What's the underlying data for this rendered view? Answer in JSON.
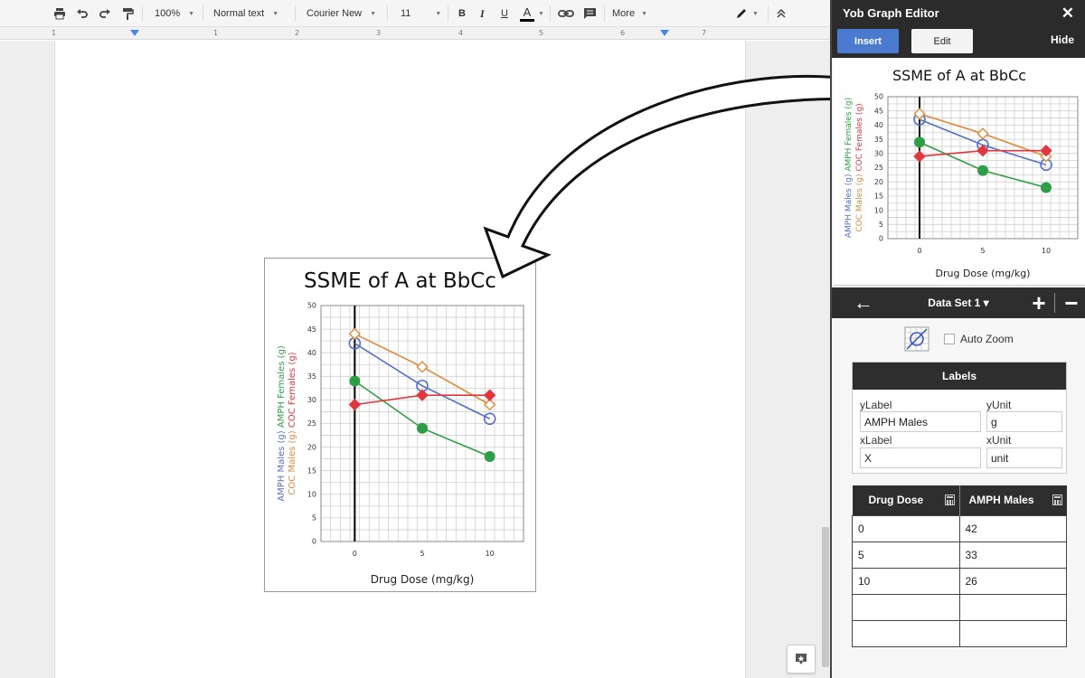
{
  "toolbar": {
    "zoom": "100%",
    "style": "Normal text",
    "font": "Courier New",
    "font_size": "11",
    "more": "More",
    "bold": "B",
    "italic": "I",
    "underline": "U",
    "text_color": "A"
  },
  "ruler": {
    "numbers": [
      "1",
      "1",
      "2",
      "3",
      "4",
      "5",
      "6",
      "7"
    ]
  },
  "sidebar": {
    "title": "Yob Graph Editor",
    "close": "✕",
    "tabs": {
      "insert": "Insert",
      "edit": "Edit"
    },
    "hide": "Hide",
    "dataset": {
      "label": "Data Set 1 ▾",
      "back": "←",
      "add": "+",
      "remove": "−"
    },
    "auto_zoom": "Auto Zoom",
    "labels_panel": {
      "title": "Labels",
      "ylabel_label": "yLabel",
      "ylabel_value": "AMPH Males",
      "yunit_label": "yUnit",
      "yunit_value": "g",
      "xlabel_label": "xLabel",
      "xlabel_value": "X",
      "xunit_label": "xUnit",
      "xunit_value": "unit"
    },
    "table": {
      "headers": [
        "Drug Dose",
        "AMPH Males"
      ],
      "rows": [
        [
          "0",
          "42"
        ],
        [
          "5",
          "33"
        ],
        [
          "10",
          "26"
        ],
        [
          "",
          ""
        ],
        [
          "",
          ""
        ]
      ]
    }
  },
  "colors": {
    "accent": "#4a7bd0",
    "amph_males": "#5470c6",
    "amph_females": "#2e9e46",
    "coc_males": "#e08a3c",
    "coc_females": "#e0373f"
  },
  "chart_data": {
    "type": "line",
    "title": "SSME of A at BbCc",
    "xlabel": "Drug Dose (mg/kg)",
    "ylabel_parts": [
      {
        "text": "AMPH Males (g)",
        "color": "#5470c6"
      },
      {
        "text": "AMPH Females (g)",
        "color": "#2e9e46"
      },
      {
        "text": "COC Males (g)",
        "color": "#e08a3c"
      },
      {
        "text": "COC Females (g)",
        "color": "#e0373f"
      }
    ],
    "x": [
      0,
      5,
      10
    ],
    "x_ticks": [
      "0",
      "5",
      "10"
    ],
    "xlim": [
      -2.5,
      12.5
    ],
    "ylim": [
      0,
      50
    ],
    "y_ticks": [
      "0",
      "5",
      "10",
      "15",
      "20",
      "25",
      "30",
      "35",
      "40",
      "45",
      "50"
    ],
    "grid": true,
    "series": [
      {
        "name": "AMPH Males (g)",
        "values": [
          42,
          33,
          26
        ],
        "color": "#5470c6",
        "marker": "open-circle"
      },
      {
        "name": "AMPH Females (g)",
        "values": [
          34,
          24,
          18
        ],
        "color": "#2e9e46",
        "marker": "filled-circle"
      },
      {
        "name": "COC Males (g)",
        "values": [
          44,
          37,
          29
        ],
        "color": "#e08a3c",
        "marker": "open-diamond"
      },
      {
        "name": "COC Females (g)",
        "values": [
          29,
          31,
          31
        ],
        "color": "#e0373f",
        "marker": "filled-diamond"
      }
    ]
  }
}
